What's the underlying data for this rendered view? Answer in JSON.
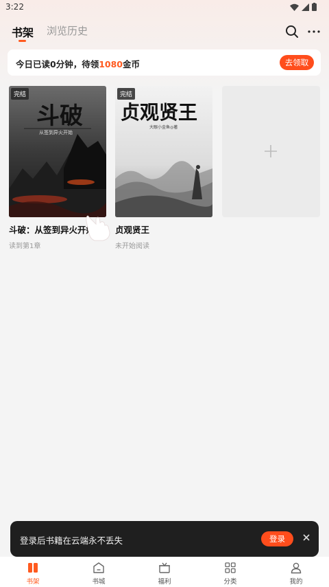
{
  "status_bar": {
    "time": "3:22"
  },
  "top_nav": {
    "tabs": [
      {
        "label": "书架",
        "active": true
      },
      {
        "label": "浏览历史",
        "active": false
      }
    ]
  },
  "banner": {
    "text_prefix": "今日已读0分钟，待领",
    "coins": "1080",
    "text_suffix": "金币",
    "button_label": "去领取"
  },
  "books": [
    {
      "title": "斗破：从签到异火开始",
      "progress": "读到第1章",
      "badge": "完结",
      "cover_title": "斗破",
      "cover_sub": "从签到异火开始"
    },
    {
      "title": "贞观贤王",
      "progress": "未开始阅读",
      "badge": "完结",
      "cover_title": "贞观贤王",
      "cover_author": "大眼小金鱼◎著"
    }
  ],
  "login_toast": {
    "message": "登录后书籍在云端永不丢失",
    "button_label": "登录"
  },
  "bottom_nav": [
    {
      "label": "书架",
      "icon": "bookshelf-icon",
      "active": true
    },
    {
      "label": "书城",
      "icon": "home-icon",
      "active": false
    },
    {
      "label": "福利",
      "icon": "gift-icon",
      "active": false
    },
    {
      "label": "分类",
      "icon": "grid-icon",
      "active": false
    },
    {
      "label": "我的",
      "icon": "user-icon",
      "active": false
    }
  ],
  "colors": {
    "accent": "#ff4d1c",
    "toast_bg": "#1f1f1f"
  }
}
